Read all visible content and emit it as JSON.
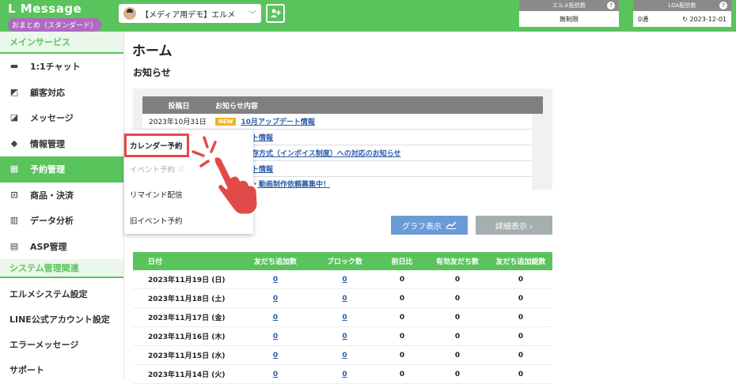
{
  "brand": {
    "title": "L Message",
    "plan": "おまとめ（スタンダード）"
  },
  "account": {
    "name": "【メディア用デモ】エルメ"
  },
  "stats": [
    {
      "label": "エルメ配信数",
      "value": "無制限"
    },
    {
      "label": "LOA配信数",
      "count": "0通",
      "date": "2023-12-01"
    }
  ],
  "sidebar": {
    "main_section": "メインサービス",
    "items": [
      {
        "label": "1:1チャット",
        "icon": "chat-icon"
      },
      {
        "label": "顧客対応",
        "icon": "customer-icon"
      },
      {
        "label": "メッセージ",
        "icon": "message-icon"
      },
      {
        "label": "情報管理",
        "icon": "tag-icon"
      },
      {
        "label": "予約管理",
        "icon": "calendar-icon"
      },
      {
        "label": "商品・決済",
        "icon": "cart-icon"
      },
      {
        "label": "データ分析",
        "icon": "chart-icon"
      },
      {
        "label": "ASP管理",
        "icon": "asp-icon"
      }
    ],
    "system_section": "システム管理関連",
    "system_items": [
      "エルメシステム設定",
      "LINE公式アカウント設定",
      "エラーメッセージ",
      "サポート"
    ]
  },
  "submenu": [
    "カレンダー予約",
    "イベント予約",
    "リマインド配信",
    "旧イベント予約"
  ],
  "main": {
    "title": "ホーム",
    "notice_title": "お知らせ",
    "notice_head": {
      "date": "投稿日",
      "content": "お知らせ内容"
    },
    "notices": [
      {
        "date": "2023年10月31日",
        "badge": "NEW",
        "text": "10月アップデート情報"
      },
      {
        "date": "",
        "badge": "",
        "text": "デート情報"
      },
      {
        "date": "",
        "badge": "",
        "text": "等保存方式（インボイス制度）への対応のお知らせ"
      },
      {
        "date": "",
        "badge": "",
        "text": "デート情報"
      },
      {
        "date": "",
        "badge": "",
        "text": "記事・動画制作依頼募集中！"
      }
    ],
    "graph_button": "グラフ表示",
    "detail_button": "詳細表示 ›"
  },
  "table": {
    "headers": [
      "日付",
      "友だち追加数",
      "ブロック数",
      "前日比",
      "有効友だち数",
      "友だち追加総数"
    ],
    "rows": [
      [
        "2023年11月19日 (日)",
        "0",
        "0",
        "0",
        "0",
        "0"
      ],
      [
        "2023年11月18日 (土)",
        "0",
        "0",
        "0",
        "0",
        "0"
      ],
      [
        "2023年11月17日 (金)",
        "0",
        "0",
        "0",
        "0",
        "0"
      ],
      [
        "2023年11月16日 (木)",
        "0",
        "0",
        "0",
        "0",
        "0"
      ],
      [
        "2023年11月15日 (水)",
        "0",
        "0",
        "0",
        "0",
        "0"
      ],
      [
        "2023年11月14日 (火)",
        "0",
        "0",
        "0",
        "0",
        "0"
      ]
    ]
  },
  "colors": {
    "brand_green": "#5ac45c",
    "highlight_red": "#e24a4a",
    "link_blue": "#2b5da8"
  }
}
